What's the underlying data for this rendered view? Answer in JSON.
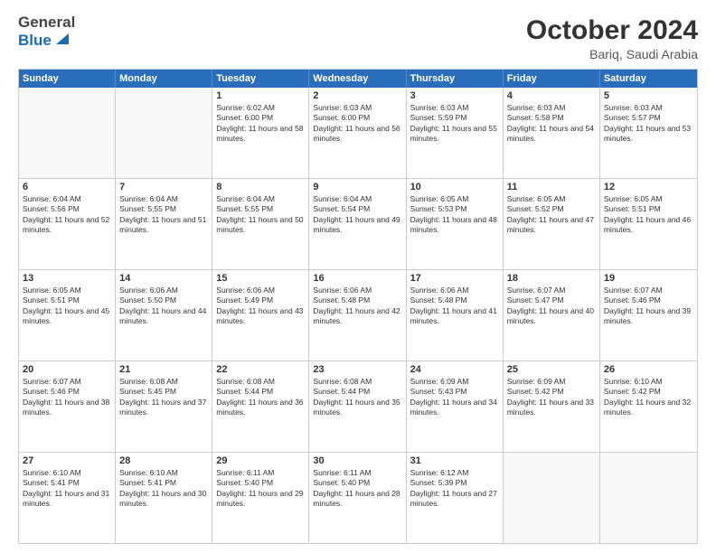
{
  "header": {
    "logo_general": "General",
    "logo_blue": "Blue",
    "month": "October 2024",
    "location": "Bariq, Saudi Arabia"
  },
  "weekdays": [
    "Sunday",
    "Monday",
    "Tuesday",
    "Wednesday",
    "Thursday",
    "Friday",
    "Saturday"
  ],
  "rows": [
    [
      {
        "day": "",
        "text": ""
      },
      {
        "day": "",
        "text": ""
      },
      {
        "day": "1",
        "text": "Sunrise: 6:02 AM\nSunset: 6:00 PM\nDaylight: 11 hours and 58 minutes."
      },
      {
        "day": "2",
        "text": "Sunrise: 6:03 AM\nSunset: 6:00 PM\nDaylight: 11 hours and 56 minutes."
      },
      {
        "day": "3",
        "text": "Sunrise: 6:03 AM\nSunset: 5:59 PM\nDaylight: 11 hours and 55 minutes."
      },
      {
        "day": "4",
        "text": "Sunrise: 6:03 AM\nSunset: 5:58 PM\nDaylight: 11 hours and 54 minutes."
      },
      {
        "day": "5",
        "text": "Sunrise: 6:03 AM\nSunset: 5:57 PM\nDaylight: 11 hours and 53 minutes."
      }
    ],
    [
      {
        "day": "6",
        "text": "Sunrise: 6:04 AM\nSunset: 5:56 PM\nDaylight: 11 hours and 52 minutes."
      },
      {
        "day": "7",
        "text": "Sunrise: 6:04 AM\nSunset: 5:55 PM\nDaylight: 11 hours and 51 minutes."
      },
      {
        "day": "8",
        "text": "Sunrise: 6:04 AM\nSunset: 5:55 PM\nDaylight: 11 hours and 50 minutes."
      },
      {
        "day": "9",
        "text": "Sunrise: 6:04 AM\nSunset: 5:54 PM\nDaylight: 11 hours and 49 minutes."
      },
      {
        "day": "10",
        "text": "Sunrise: 6:05 AM\nSunset: 5:53 PM\nDaylight: 11 hours and 48 minutes."
      },
      {
        "day": "11",
        "text": "Sunrise: 6:05 AM\nSunset: 5:52 PM\nDaylight: 11 hours and 47 minutes."
      },
      {
        "day": "12",
        "text": "Sunrise: 6:05 AM\nSunset: 5:51 PM\nDaylight: 11 hours and 46 minutes."
      }
    ],
    [
      {
        "day": "13",
        "text": "Sunrise: 6:05 AM\nSunset: 5:51 PM\nDaylight: 11 hours and 45 minutes."
      },
      {
        "day": "14",
        "text": "Sunrise: 6:06 AM\nSunset: 5:50 PM\nDaylight: 11 hours and 44 minutes."
      },
      {
        "day": "15",
        "text": "Sunrise: 6:06 AM\nSunset: 5:49 PM\nDaylight: 11 hours and 43 minutes."
      },
      {
        "day": "16",
        "text": "Sunrise: 6:06 AM\nSunset: 5:48 PM\nDaylight: 11 hours and 42 minutes."
      },
      {
        "day": "17",
        "text": "Sunrise: 6:06 AM\nSunset: 5:48 PM\nDaylight: 11 hours and 41 minutes."
      },
      {
        "day": "18",
        "text": "Sunrise: 6:07 AM\nSunset: 5:47 PM\nDaylight: 11 hours and 40 minutes."
      },
      {
        "day": "19",
        "text": "Sunrise: 6:07 AM\nSunset: 5:46 PM\nDaylight: 11 hours and 39 minutes."
      }
    ],
    [
      {
        "day": "20",
        "text": "Sunrise: 6:07 AM\nSunset: 5:46 PM\nDaylight: 11 hours and 38 minutes."
      },
      {
        "day": "21",
        "text": "Sunrise: 6:08 AM\nSunset: 5:45 PM\nDaylight: 11 hours and 37 minutes."
      },
      {
        "day": "22",
        "text": "Sunrise: 6:08 AM\nSunset: 5:44 PM\nDaylight: 11 hours and 36 minutes."
      },
      {
        "day": "23",
        "text": "Sunrise: 6:08 AM\nSunset: 5:44 PM\nDaylight: 11 hours and 35 minutes."
      },
      {
        "day": "24",
        "text": "Sunrise: 6:09 AM\nSunset: 5:43 PM\nDaylight: 11 hours and 34 minutes."
      },
      {
        "day": "25",
        "text": "Sunrise: 6:09 AM\nSunset: 5:42 PM\nDaylight: 11 hours and 33 minutes."
      },
      {
        "day": "26",
        "text": "Sunrise: 6:10 AM\nSunset: 5:42 PM\nDaylight: 11 hours and 32 minutes."
      }
    ],
    [
      {
        "day": "27",
        "text": "Sunrise: 6:10 AM\nSunset: 5:41 PM\nDaylight: 11 hours and 31 minutes."
      },
      {
        "day": "28",
        "text": "Sunrise: 6:10 AM\nSunset: 5:41 PM\nDaylight: 11 hours and 30 minutes."
      },
      {
        "day": "29",
        "text": "Sunrise: 6:11 AM\nSunset: 5:40 PM\nDaylight: 11 hours and 29 minutes."
      },
      {
        "day": "30",
        "text": "Sunrise: 6:11 AM\nSunset: 5:40 PM\nDaylight: 11 hours and 28 minutes."
      },
      {
        "day": "31",
        "text": "Sunrise: 6:12 AM\nSunset: 5:39 PM\nDaylight: 11 hours and 27 minutes."
      },
      {
        "day": "",
        "text": ""
      },
      {
        "day": "",
        "text": ""
      }
    ]
  ]
}
